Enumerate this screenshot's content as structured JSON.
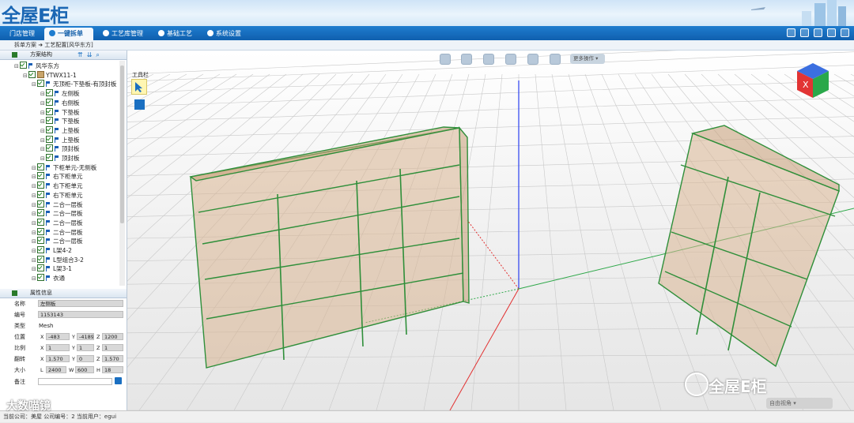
{
  "app": {
    "logo": "全屋E柜"
  },
  "nav": {
    "tabs": [
      {
        "label": "门店管理"
      },
      {
        "label": "一键拆单",
        "active": true
      },
      {
        "label": "工艺库管理"
      },
      {
        "label": "基础工艺"
      },
      {
        "label": "系统设置"
      }
    ]
  },
  "breadcrumb": "拆单方案 ➜ 工艺配置[风华东方]",
  "tree": {
    "title": "方案结构",
    "nodes": [
      {
        "label": "风华东方",
        "level": 0,
        "icon": "flag"
      },
      {
        "label": "YTWX11-1",
        "level": 1,
        "icon": "cube"
      },
      {
        "label": "无顶柜-下垫板-有顶封板",
        "level": 2,
        "icon": "flag"
      },
      {
        "label": "左侧板",
        "level": 3,
        "icon": "flag"
      },
      {
        "label": "右侧板",
        "level": 3,
        "icon": "flag"
      },
      {
        "label": "下垫板",
        "level": 3,
        "icon": "flag"
      },
      {
        "label": "下垫板",
        "level": 3,
        "icon": "flag"
      },
      {
        "label": "上垫板",
        "level": 3,
        "icon": "flag"
      },
      {
        "label": "上垫板",
        "level": 3,
        "icon": "flag"
      },
      {
        "label": "顶封板",
        "level": 3,
        "icon": "flag"
      },
      {
        "label": "顶封板",
        "level": 3,
        "icon": "flag"
      },
      {
        "label": "下柜单元-无侧板",
        "level": 2,
        "icon": "flag"
      },
      {
        "label": "右下柜单元",
        "level": 2,
        "icon": "flag"
      },
      {
        "label": "右下柜单元",
        "level": 2,
        "icon": "flag"
      },
      {
        "label": "右下柜单元",
        "level": 2,
        "icon": "flag"
      },
      {
        "label": "二合一层板",
        "level": 2,
        "icon": "flag"
      },
      {
        "label": "二合一层板",
        "level": 2,
        "icon": "flag"
      },
      {
        "label": "二合一层板",
        "level": 2,
        "icon": "flag"
      },
      {
        "label": "二合一层板",
        "level": 2,
        "icon": "flag"
      },
      {
        "label": "二合一层板",
        "level": 2,
        "icon": "flag"
      },
      {
        "label": "L架4-2",
        "level": 2,
        "icon": "flag"
      },
      {
        "label": "L型组合3-2",
        "level": 2,
        "icon": "flag"
      },
      {
        "label": "L架3-1",
        "level": 2,
        "icon": "flag"
      },
      {
        "label": "衣通",
        "level": 2,
        "icon": "flag"
      }
    ]
  },
  "attrs": {
    "title": "属性信息",
    "name_label": "名称",
    "name": "左侧板",
    "code_label": "编号",
    "code": "1153143",
    "type_label": "类型",
    "type": "Mesh",
    "pos_label": "位置",
    "pos": {
      "x": "-483",
      "y": "-4189",
      "z": "1200"
    },
    "scale_label": "比例",
    "scale": {
      "x": "1",
      "y": "1",
      "z": "1"
    },
    "rot_label": "翻转",
    "rot": {
      "x": "1.570",
      "y": "0",
      "z": "1.570"
    },
    "size_label": "大小",
    "size": {
      "l": "2400",
      "w": "600",
      "h": "18"
    },
    "note_label": "备注",
    "note": ""
  },
  "viewport": {
    "toolbox_label": "工具栏",
    "more_label": "更多操作",
    "view_select": "自由视角",
    "watermark": "全屋E柜",
    "cube_label": "X"
  },
  "status": "当前公司：美屋   公司编号：2   当前用户：egui",
  "corner_watermark": "大数喵镜",
  "colors": {
    "nav": "#1466b8",
    "panel_wood": "#d9b592",
    "panel_edge": "#2f8f3a"
  }
}
